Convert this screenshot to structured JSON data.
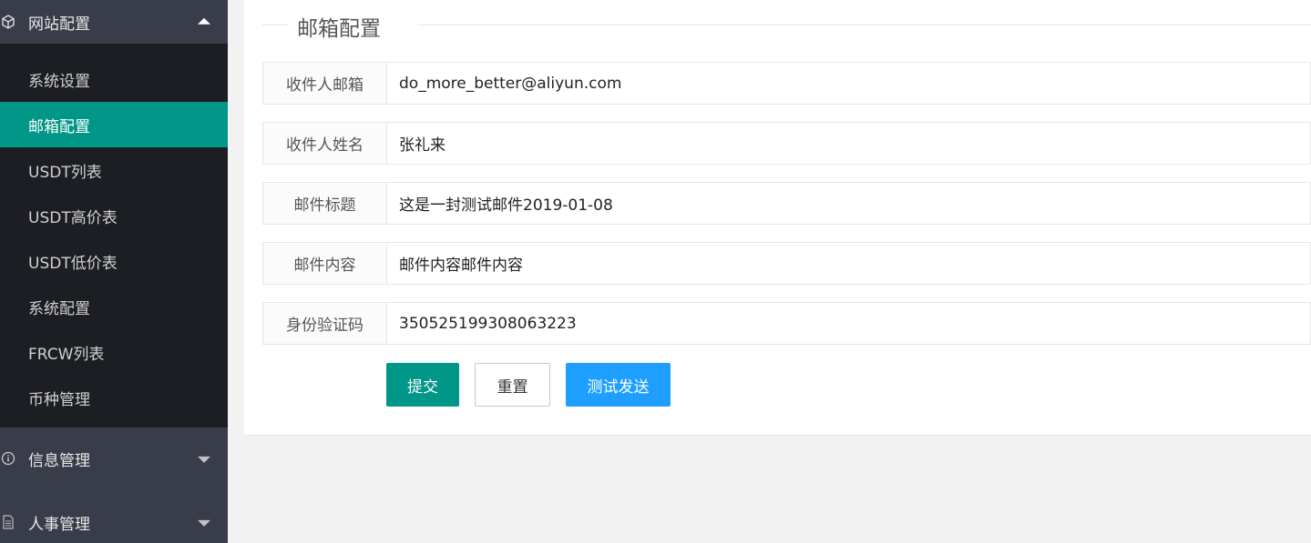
{
  "sidebar": {
    "groups": [
      {
        "label": "网站配置",
        "expanded": true,
        "icon": "cube-icon",
        "items": [
          {
            "label": "系统设置",
            "active": false
          },
          {
            "label": "邮箱配置",
            "active": true
          },
          {
            "label": "USDT列表",
            "active": false
          },
          {
            "label": "USDT高价表",
            "active": false
          },
          {
            "label": "USDT低价表",
            "active": false
          },
          {
            "label": "系统配置",
            "active": false
          },
          {
            "label": "FRCW列表",
            "active": false
          },
          {
            "label": "币种管理",
            "active": false
          }
        ]
      },
      {
        "label": "信息管理",
        "expanded": false,
        "icon": "info-icon"
      },
      {
        "label": "人事管理",
        "expanded": false,
        "icon": "document-icon"
      }
    ]
  },
  "main": {
    "section_title": "邮箱配置",
    "fields": [
      {
        "label": "收件人邮箱",
        "value": "do_more_better@aliyun.com"
      },
      {
        "label": "收件人姓名",
        "value": "张礼来"
      },
      {
        "label": "邮件标题",
        "value": "这是一封测试邮件2019-01-08"
      },
      {
        "label": "邮件内容",
        "value": "邮件内容邮件内容"
      },
      {
        "label": "身份验证码",
        "value": "350525199308063223"
      }
    ],
    "buttons": {
      "submit": "提交",
      "reset": "重置",
      "test_send": "测试发送"
    }
  },
  "colors": {
    "sidebar_bg": "#393d49",
    "submenu_bg": "#1c1e23",
    "active_green": "#009688",
    "test_blue": "#1e9fff"
  }
}
